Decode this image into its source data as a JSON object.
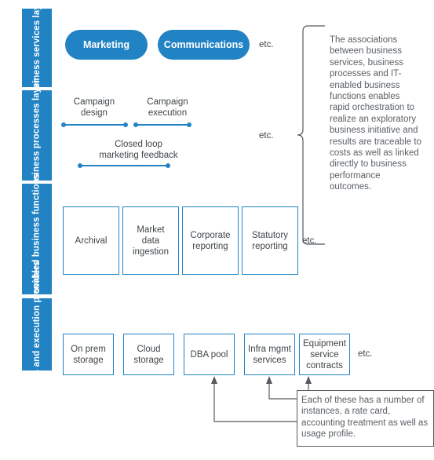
{
  "layers": [
    {
      "id": "business-services",
      "label": "Business\nservices layer"
    },
    {
      "id": "business-processes",
      "label": "Business\nprocesses layer"
    },
    {
      "id": "it-enabled-functions",
      "label": "IT enabled\nbusiness functions"
    },
    {
      "id": "it-assets",
      "label": "IT assets and\nexecution providers"
    }
  ],
  "business_services": {
    "pills": [
      {
        "label": "Marketing"
      },
      {
        "label": "Communications"
      }
    ],
    "etc": "etc."
  },
  "business_processes": {
    "processes": [
      {
        "label": "Campaign\ndesign"
      },
      {
        "label": "Campaign\nexecution"
      },
      {
        "label": "Closed loop\nmarketing feedback"
      }
    ],
    "etc": "etc."
  },
  "it_functions": {
    "boxes": [
      {
        "label": "Archival"
      },
      {
        "label": "Market\ndata\ningestion"
      },
      {
        "label": "Corporate\nreporting"
      },
      {
        "label": "Statutory\nreporting"
      }
    ],
    "etc": "etc."
  },
  "it_assets": {
    "boxes": [
      {
        "label": "On prem\nstorage"
      },
      {
        "label": "Cloud\nstorage"
      },
      {
        "label": "DBA pool"
      },
      {
        "label": "Infra mgmt\nservices"
      },
      {
        "label": "Equipment\nservice\ncontracts"
      }
    ],
    "etc": "etc."
  },
  "annotations": {
    "right_brace_note": "The associations between business services, business processes and IT-enabled business functions enables rapid orchestration to realize an exploratory business initiative and results are traceable to costs as well as linked directly to business performance outcomes.",
    "bottom_note": "Each of these has a number of instances, a rate card, accounting treatment as well as usage profile."
  },
  "colors": {
    "brand_blue": "#2183c4",
    "text_gray": "#3f4549",
    "annotation_gray": "#5a6066",
    "connector_gray": "#555b60",
    "background": "#ffffff"
  }
}
